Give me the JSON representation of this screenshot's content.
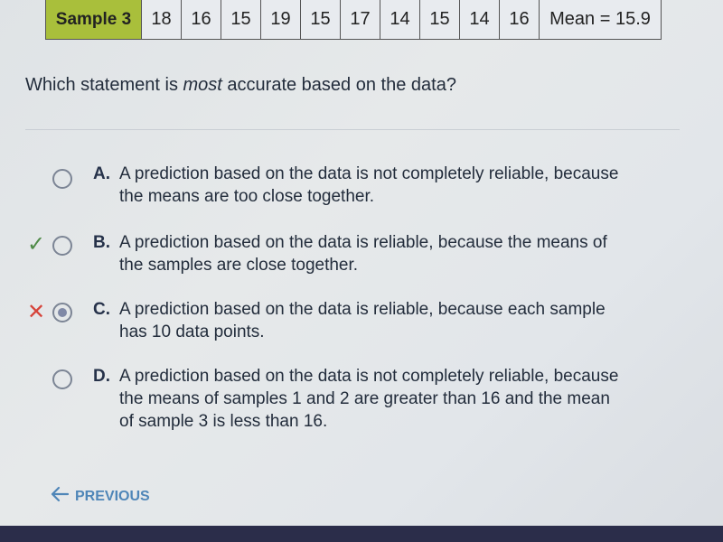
{
  "table": {
    "label": "Sample 3",
    "values": [
      "18",
      "16",
      "15",
      "19",
      "15",
      "17",
      "14",
      "15",
      "14",
      "16"
    ],
    "mean": "Mean = 15.9"
  },
  "question": {
    "prefix": "Which statement is ",
    "emphasis": "most",
    "suffix": " accurate based on the data?"
  },
  "options": [
    {
      "letter": "A.",
      "line1": "A prediction based on the data is not completely reliable, because",
      "line2": "the means are too close together.",
      "line3": "",
      "selected": false,
      "mark": ""
    },
    {
      "letter": "B.",
      "line1": "A prediction based on the data is reliable, because the means of",
      "line2": "the samples are close together.",
      "line3": "",
      "selected": false,
      "mark": "correct"
    },
    {
      "letter": "C.",
      "line1": "A prediction based on the data is reliable, because each sample",
      "line2": "has 10 data points.",
      "line3": "",
      "selected": true,
      "mark": "incorrect"
    },
    {
      "letter": "D.",
      "line1": "A prediction based on the data is not completely reliable, because",
      "line2": "the means of samples 1 and 2 are greater than 16 and the mean",
      "line3": "of sample 3 is less than 16.",
      "selected": false,
      "mark": ""
    }
  ],
  "marks": {
    "correct": "✓",
    "incorrect": "✕"
  },
  "nav": {
    "previous_label": "PREVIOUS"
  },
  "colors": {
    "label_cell": "#a9bf3b",
    "link": "#4f86b8",
    "correct": "#4f8a47",
    "incorrect": "#d6443b"
  }
}
